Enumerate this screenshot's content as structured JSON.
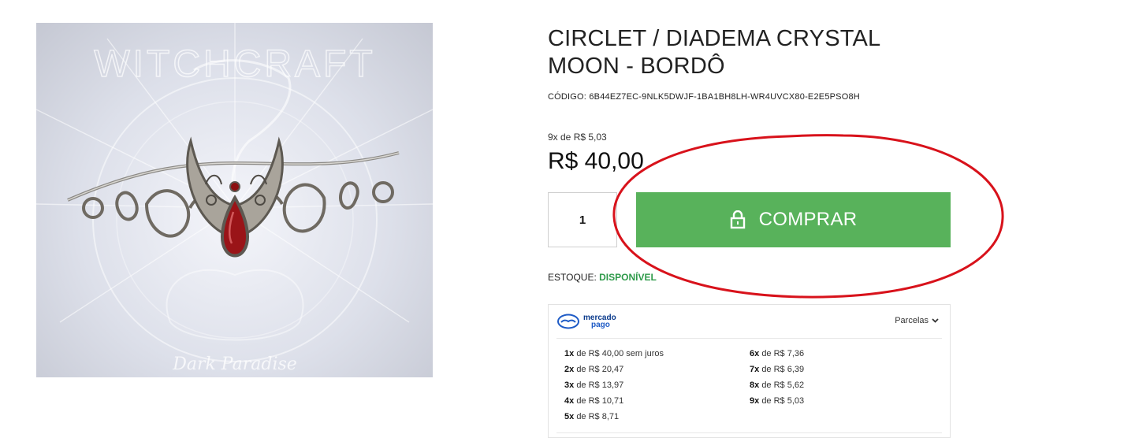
{
  "product": {
    "title_line1": "CIRCLET / DIADEMA CRYSTAL",
    "title_line2": "MOON - BORDÔ",
    "code_label": "CÓDIGO:",
    "code_value": "6B44EZ7EC-9NLK5DWJF-1BA1BH8LH-WR4UVCX80-E2E5PSO8H",
    "installment_hint": "9x de R$ 5,03",
    "price": "R$ 40,00",
    "image": {
      "watermark_title": "WITCHCRAFT",
      "watermark_sign": "Dark Paradise"
    }
  },
  "purchase": {
    "quantity": "1",
    "buy_label": "COMPRAR",
    "buy_icon": "lock-icon",
    "button_color": "#58b25b"
  },
  "stock": {
    "label": "ESTOQUE:",
    "status": "DISPONÍVEL",
    "status_color": "#2e9a4a"
  },
  "payment": {
    "provider_line1": "mercado",
    "provider_line2": "pago",
    "dropdown_label": "Parcelas",
    "installments_left": [
      {
        "n": "1x",
        "text": "de R$ 40,00 sem juros"
      },
      {
        "n": "2x",
        "text": "de R$ 20,47"
      },
      {
        "n": "3x",
        "text": "de R$ 13,97"
      },
      {
        "n": "4x",
        "text": "de R$ 10,71"
      },
      {
        "n": "5x",
        "text": "de R$ 8,71"
      }
    ],
    "installments_right": [
      {
        "n": "6x",
        "text": "de R$ 7,36"
      },
      {
        "n": "7x",
        "text": "de R$ 6,39"
      },
      {
        "n": "8x",
        "text": "de R$ 5,62"
      },
      {
        "n": "9x",
        "text": "de R$ 5,03"
      }
    ]
  },
  "annotation": {
    "ellipse_color": "#d8121b"
  }
}
